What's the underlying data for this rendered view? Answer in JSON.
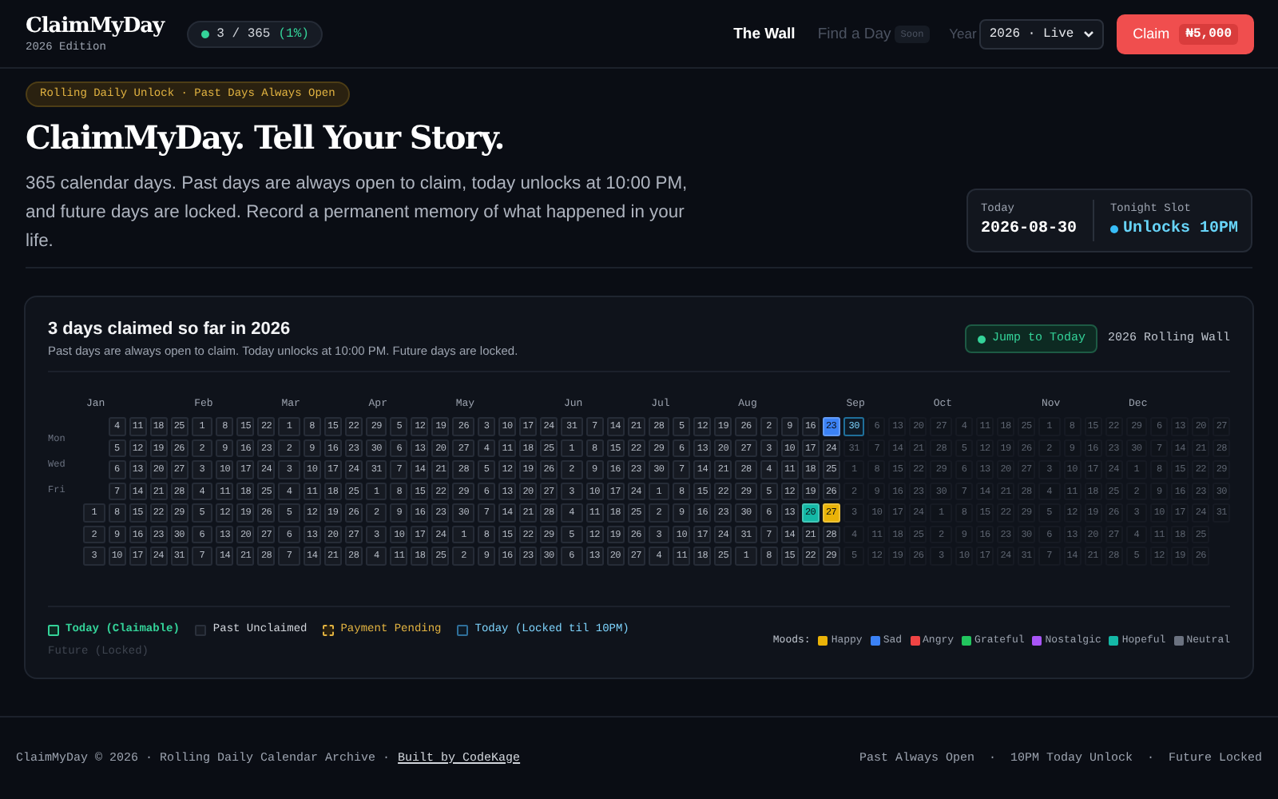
{
  "header": {
    "logo": "ClaimMyDay",
    "edition": "2026 Edition",
    "progress": {
      "claimed": "3 / 365",
      "percent": "(1%)"
    },
    "nav": [
      {
        "label": "The Wall",
        "selected": true,
        "disabled": false
      },
      {
        "label": "Find a Day",
        "selected": false,
        "disabled": true,
        "badge": "Soon"
      }
    ],
    "year_label": "Year",
    "year_value": "2026 · Live",
    "claim_button": {
      "label": "Claim",
      "price": "₦5,000"
    }
  },
  "hero": {
    "badge": "Rolling Daily Unlock · Past Days Always Open",
    "title": "ClaimMyDay. Tell Your Story.",
    "text": "365 calendar days. Past days are always open to claim, today unlocks at 10:00 PM, and future days are locked. Record a permanent memory of what happened in your life.",
    "today_label": "Today",
    "today_value": "2026-08-30",
    "slot_label": "Tonight Slot",
    "slot_value": "Unlocks 10PM"
  },
  "wall": {
    "title": "3 days claimed so far in 2026",
    "subtitle": "Past days are always open to claim. Today unlocks at 10:00 PM. Future days are locked.",
    "jump_button": "Jump to Today",
    "wall_label": "2026 Rolling Wall",
    "weekday_labels": [
      "Mon",
      "Wed",
      "Fri"
    ],
    "weeks": [
      {
        "month": "Jan",
        "future": false,
        "days": [
          "1",
          "2",
          "3"
        ]
      },
      {
        "future": false,
        "days": [
          "4",
          "5",
          "6",
          "7",
          "8",
          "9",
          "10"
        ]
      },
      {
        "future": false,
        "days": [
          "11",
          "12",
          "13",
          "14",
          "15",
          "16",
          "17"
        ]
      },
      {
        "future": false,
        "days": [
          "18",
          "19",
          "20",
          "21",
          "22",
          "23",
          "24"
        ]
      },
      {
        "future": false,
        "days": [
          "25",
          "26",
          "27",
          "28",
          "29",
          "30",
          "31"
        ]
      },
      {
        "month": "Feb",
        "future": false,
        "days": [
          "1",
          "2",
          "3",
          "4",
          "5",
          "6",
          "7"
        ]
      },
      {
        "future": false,
        "days": [
          "8",
          "9",
          "10",
          "11",
          "12",
          "13",
          "14"
        ]
      },
      {
        "future": false,
        "days": [
          "15",
          "16",
          "17",
          "18",
          "19",
          "20",
          "21"
        ]
      },
      {
        "future": false,
        "days": [
          "22",
          "23",
          "24",
          "25",
          "26",
          "27",
          "28"
        ]
      },
      {
        "month": "Mar",
        "future": false,
        "days": [
          "1",
          "2",
          "3",
          "4",
          "5",
          "6",
          "7"
        ]
      },
      {
        "future": false,
        "days": [
          "8",
          "9",
          "10",
          "11",
          "12",
          "13",
          "14"
        ]
      },
      {
        "future": false,
        "days": [
          "15",
          "16",
          "17",
          "18",
          "19",
          "20",
          "21"
        ]
      },
      {
        "future": false,
        "days": [
          "22",
          "23",
          "24",
          "25",
          "26",
          "27",
          "28"
        ]
      },
      {
        "month": "Apr",
        "future": false,
        "days": [
          "29",
          "30",
          "31",
          "1",
          "2",
          "3",
          "4"
        ]
      },
      {
        "future": false,
        "days": [
          "5",
          "6",
          "7",
          "8",
          "9",
          "10",
          "11"
        ]
      },
      {
        "future": false,
        "days": [
          "12",
          "13",
          "14",
          "15",
          "16",
          "17",
          "18"
        ]
      },
      {
        "future": false,
        "days": [
          "19",
          "20",
          "21",
          "22",
          "23",
          "24",
          "25"
        ]
      },
      {
        "month": "May",
        "future": false,
        "days": [
          "26",
          "27",
          "28",
          "29",
          "30",
          "1",
          "2"
        ]
      },
      {
        "future": false,
        "days": [
          "3",
          "4",
          "5",
          "6",
          "7",
          "8",
          "9"
        ]
      },
      {
        "future": false,
        "days": [
          "10",
          "11",
          "12",
          "13",
          "14",
          "15",
          "16"
        ]
      },
      {
        "future": false,
        "days": [
          "17",
          "18",
          "19",
          "20",
          "21",
          "22",
          "23"
        ]
      },
      {
        "future": false,
        "days": [
          "24",
          "25",
          "26",
          "27",
          "28",
          "29",
          "30"
        ]
      },
      {
        "month": "Jun",
        "future": false,
        "days": [
          "31",
          "1",
          "2",
          "3",
          "4",
          "5",
          "6"
        ]
      },
      {
        "future": false,
        "days": [
          "7",
          "8",
          "9",
          "10",
          "11",
          "12",
          "13"
        ]
      },
      {
        "future": false,
        "days": [
          "14",
          "15",
          "16",
          "17",
          "18",
          "19",
          "20"
        ]
      },
      {
        "future": false,
        "days": [
          "21",
          "22",
          "23",
          "24",
          "25",
          "26",
          "27"
        ]
      },
      {
        "month": "Jul",
        "future": false,
        "days": [
          "28",
          "29",
          "30",
          "1",
          "2",
          "3",
          "4"
        ]
      },
      {
        "future": false,
        "days": [
          "5",
          "6",
          "7",
          "8",
          "9",
          "10",
          "11"
        ]
      },
      {
        "future": false,
        "days": [
          "12",
          "13",
          "14",
          "15",
          "16",
          "17",
          "18"
        ]
      },
      {
        "future": false,
        "days": [
          "19",
          "20",
          "21",
          "22",
          "23",
          "24",
          "25"
        ]
      },
      {
        "month": "Aug",
        "future": false,
        "days": [
          "26",
          "27",
          "28",
          "29",
          "30",
          "31",
          "1"
        ]
      },
      {
        "future": false,
        "days": [
          "2",
          "3",
          "4",
          "5",
          "6",
          "7",
          "8"
        ]
      },
      {
        "future": false,
        "days": [
          "9",
          "10",
          "11",
          "12",
          "13",
          "14",
          "15"
        ]
      },
      {
        "future": false,
        "days": [
          "16",
          "17",
          "18",
          "19",
          {
            "day": "20",
            "claimed": true,
            "color": "#14b8a6"
          },
          "21",
          "22"
        ]
      },
      {
        "future": false,
        "days": [
          {
            "day": "23",
            "claimed": true,
            "color": "#3b82f6"
          },
          "24",
          "25",
          "26",
          {
            "day": "27",
            "claimed": true,
            "color": "#eab308"
          },
          "28",
          "29"
        ]
      },
      {
        "month": "Sep",
        "future": true,
        "days": [
          {
            "day": "30",
            "today": true
          },
          "31",
          "1",
          "2",
          "3",
          "4",
          "5"
        ]
      },
      {
        "future": true,
        "days": [
          "6",
          "7",
          "8",
          "9",
          "10",
          "11",
          "12"
        ]
      },
      {
        "future": true,
        "days": [
          "13",
          "14",
          "15",
          "16",
          "17",
          "18",
          "19"
        ]
      },
      {
        "future": true,
        "days": [
          "20",
          "21",
          "22",
          "23",
          "24",
          "25",
          "26"
        ]
      },
      {
        "month": "Oct",
        "future": true,
        "days": [
          "27",
          "28",
          "29",
          "30",
          "1",
          "2",
          "3"
        ]
      },
      {
        "future": true,
        "days": [
          "4",
          "5",
          "6",
          "7",
          "8",
          "9",
          "10"
        ]
      },
      {
        "future": true,
        "days": [
          "11",
          "12",
          "13",
          "14",
          "15",
          "16",
          "17"
        ]
      },
      {
        "future": true,
        "days": [
          "18",
          "19",
          "20",
          "21",
          "22",
          "23",
          "24"
        ]
      },
      {
        "future": true,
        "days": [
          "25",
          "26",
          "27",
          "28",
          "29",
          "30",
          "31"
        ]
      },
      {
        "month": "Nov",
        "future": true,
        "days": [
          "1",
          "2",
          "3",
          "4",
          "5",
          "6",
          "7"
        ]
      },
      {
        "future": true,
        "days": [
          "8",
          "9",
          "10",
          "11",
          "12",
          "13",
          "14"
        ]
      },
      {
        "future": true,
        "days": [
          "15",
          "16",
          "17",
          "18",
          "19",
          "20",
          "21"
        ]
      },
      {
        "future": true,
        "days": [
          "22",
          "23",
          "24",
          "25",
          "26",
          "27",
          "28"
        ]
      },
      {
        "month": "Dec",
        "future": true,
        "days": [
          "29",
          "30",
          "1",
          "2",
          "3",
          "4",
          "5"
        ]
      },
      {
        "future": true,
        "days": [
          "6",
          "7",
          "8",
          "9",
          "10",
          "11",
          "12"
        ]
      },
      {
        "future": true,
        "days": [
          "13",
          "14",
          "15",
          "16",
          "17",
          "18",
          "19"
        ]
      },
      {
        "future": true,
        "days": [
          "20",
          "21",
          "22",
          "23",
          "24",
          "25",
          "26"
        ]
      },
      {
        "future": true,
        "days": [
          "27",
          "28",
          "29",
          "30",
          "31"
        ]
      }
    ],
    "legend": [
      {
        "kind": "today",
        "label": "Today (Claimable)"
      },
      {
        "kind": "unclaimed",
        "label": "Past Unclaimed"
      },
      {
        "kind": "pending",
        "label": "Payment Pending"
      },
      {
        "kind": "locked",
        "label": "Today (Locked til 10PM)"
      },
      {
        "kind": "future",
        "label": "Future (Locked)"
      }
    ],
    "moods_label": "Moods:",
    "moods": [
      {
        "label": "Happy",
        "color": "#eab308"
      },
      {
        "label": "Sad",
        "color": "#3b82f6"
      },
      {
        "label": "Angry",
        "color": "#ef4444"
      },
      {
        "label": "Grateful",
        "color": "#22c55e"
      },
      {
        "label": "Nostalgic",
        "color": "#a855f7"
      },
      {
        "label": "Hopeful",
        "color": "#14b8a6"
      },
      {
        "label": "Neutral",
        "color": "#6b7280"
      }
    ]
  },
  "footer": {
    "text": "ClaimMyDay © 2026 · Rolling Daily Calendar Archive ·",
    "link": "Built by CodeKage",
    "right": "Past Always Open  ·  10PM Today Unlock  ·  Future Locked"
  }
}
